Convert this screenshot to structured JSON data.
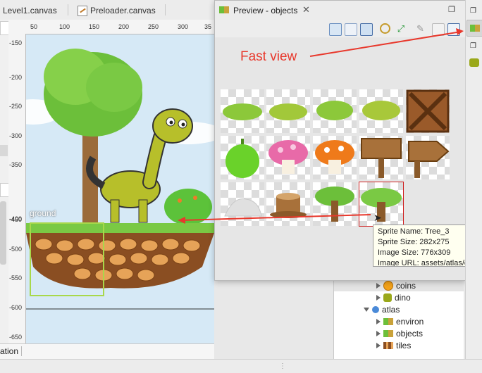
{
  "editor": {
    "tabs": [
      {
        "label": "Level1.canvas"
      },
      {
        "label": "Preloader.canvas"
      }
    ],
    "ruler_x": [
      "50",
      "100",
      "150",
      "200",
      "250",
      "300",
      "35"
    ],
    "ruler_y": [
      "-150",
      "-400",
      "-450",
      "-500",
      "-550",
      "-600",
      "-650"
    ],
    "ground_label": "ground",
    "bottom_tab_label": "ation"
  },
  "preview": {
    "title": "Preview - objects",
    "annotation": "Fast view",
    "tooltip": {
      "sprite_name": "Sprite Name: Tree_3",
      "sprite_size": "Sprite Size: 282x275",
      "image_size": "Image Size: 776x309",
      "image_url": "Image URL: assets/atlas/obje"
    },
    "sprites": [
      {
        "name": "bush-1"
      },
      {
        "name": "bush-2"
      },
      {
        "name": "bush-3"
      },
      {
        "name": "bush-4"
      },
      {
        "name": "crate"
      },
      {
        "name": "green-ball"
      },
      {
        "name": "pink-mushroom"
      },
      {
        "name": "orange-mushroom"
      },
      {
        "name": "sign"
      },
      {
        "name": "arrow-sign"
      },
      {
        "name": "rock"
      },
      {
        "name": "stump"
      },
      {
        "name": "tree-small"
      },
      {
        "name": "tree-3"
      }
    ]
  },
  "tree": {
    "items": [
      {
        "label": "coins",
        "icon": "coin-icon"
      },
      {
        "label": "dino",
        "icon": "dino-icon"
      },
      {
        "label": "atlas",
        "icon": "atlas-icon"
      },
      {
        "label": "environ",
        "icon": "sprites-icon"
      },
      {
        "label": "objects",
        "icon": "sprites-icon"
      },
      {
        "label": "tiles",
        "icon": "tiles-icon"
      }
    ]
  },
  "colors": {
    "accent_red": "#e8382c",
    "canvas_bg": "#d6e9f6",
    "selection_green": "#a8d84a"
  }
}
